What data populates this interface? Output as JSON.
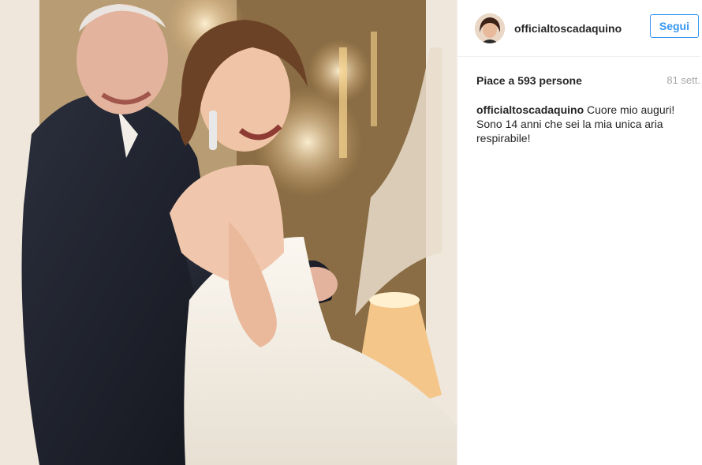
{
  "post": {
    "username": "officialtoscadaquino",
    "follow_label": "Segui",
    "likes_text": "Piace a 593 persone",
    "timestamp": "81 sett.",
    "caption_user": "officialtoscadaquino",
    "caption_text": "Cuore mio auguri! Sono 14 anni che sei la mia unica aria respirabile!"
  },
  "icons": {
    "avatar": "profile-avatar"
  }
}
